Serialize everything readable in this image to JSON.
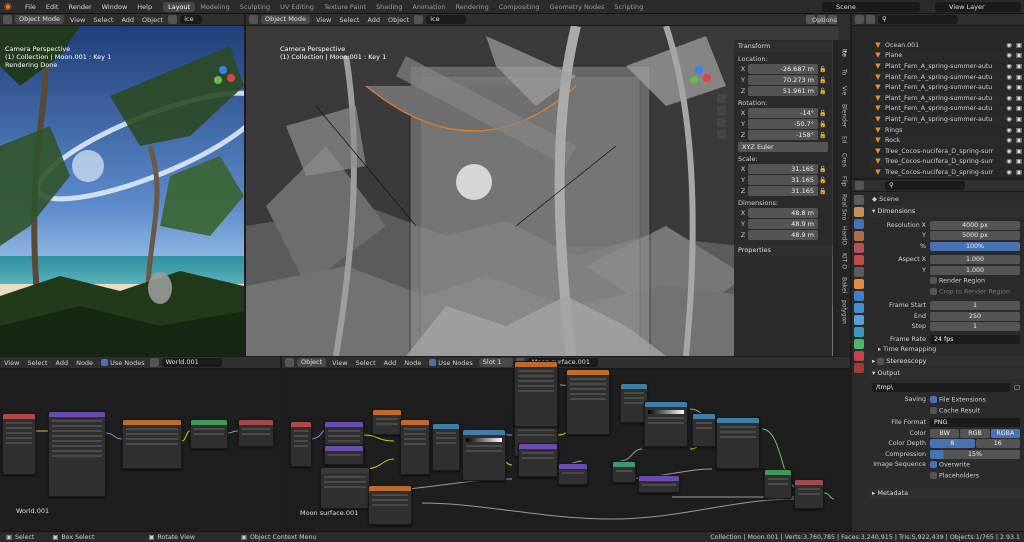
{
  "menu": {
    "items": [
      "File",
      "Edit",
      "Render",
      "Window",
      "Help"
    ]
  },
  "workspaces": [
    {
      "label": "Layout",
      "active": true
    },
    {
      "label": "Modeling",
      "active": false
    },
    {
      "label": "Sculpting",
      "active": false
    },
    {
      "label": "UV Editing",
      "active": false
    },
    {
      "label": "Texture Paint",
      "active": false
    },
    {
      "label": "Shading",
      "active": false
    },
    {
      "label": "Animation",
      "active": false
    },
    {
      "label": "Rendering",
      "active": false
    },
    {
      "label": "Compositing",
      "active": false
    },
    {
      "label": "Geometry Nodes",
      "active": false
    },
    {
      "label": "Scripting",
      "active": false
    }
  ],
  "scene": {
    "name": "Scene",
    "view_layer": "View Layer"
  },
  "left_viewport": {
    "mode": "Object Mode",
    "menus": [
      "View",
      "Select",
      "Add",
      "Object"
    ],
    "transform_orientation": "Global",
    "search": "ice",
    "overlay_lines": [
      "Camera Perspective",
      "(1) Collection | Moon.001 : Key 1",
      "Rendering Done"
    ],
    "options_label": "Opti"
  },
  "main_viewport": {
    "mode": "Object Mode",
    "menus": [
      "View",
      "Select",
      "Add",
      "Object"
    ],
    "transform_orientation": "Global",
    "search": "ice",
    "options_label": "Options",
    "overlay_lines": [
      "Camera Perspective",
      "(1) Collection | Moon.001 : Key 1"
    ],
    "side_tabs": [
      "Ite",
      "To",
      "Vie",
      "Blender",
      "Ed",
      "Crea",
      "Flip",
      "Real Sno",
      "HardO",
      "KIT O",
      "Bakel",
      "polygon"
    ]
  },
  "npanel": {
    "transform_title": "Transform",
    "location_label": "Location:",
    "location": [
      {
        "ax": "X",
        "val": "-26.687 m"
      },
      {
        "ax": "Y",
        "val": "70.273 m"
      },
      {
        "ax": "Z",
        "val": "51.961 m"
      }
    ],
    "rotation_label": "Rotation:",
    "rotation": [
      {
        "ax": "X",
        "val": "-14°"
      },
      {
        "ax": "Y",
        "val": "-50.7°"
      },
      {
        "ax": "Z",
        "val": "-158°"
      }
    ],
    "rotation_mode": "XYZ Euler",
    "scale_label": "Scale:",
    "scale": [
      {
        "ax": "X",
        "val": "31.165"
      },
      {
        "ax": "Y",
        "val": "31.165"
      },
      {
        "ax": "Z",
        "val": "31.165"
      }
    ],
    "dimensions_label": "Dimensions:",
    "dimensions": [
      {
        "ax": "X",
        "val": "48.8 m"
      },
      {
        "ax": "Y",
        "val": "48.9 m"
      },
      {
        "ax": "Z",
        "val": "48.9 m"
      }
    ],
    "properties_title": "Properties"
  },
  "outliner": {
    "rows": [
      "Ocean.001",
      "Plane",
      "Plant_Fern_A_spring-summer-autu",
      "Plant_Fern_A_spring-summer-autu",
      "Plant_Fern_A_spring-summer-autu",
      "Plant_Fern_A_spring-summer-autu",
      "Plant_Fern_A_spring-summer-autu",
      "Plant_Fern_A_spring-summer-autu",
      "Rings",
      "Rock",
      "Tree_Cocos-nucifera_D_spring-surr",
      "Tree_Cocos-nucifera_D_spring-surr",
      "Tree_Cocos-nucifera_D_spring-surr"
    ]
  },
  "properties": {
    "breadcrumb": "Scene",
    "dimensions_title": "Dimensions",
    "resolution_x_label": "Resolution X",
    "resolution_x": "4000 px",
    "resolution_y_label": "Y",
    "resolution_y": "5000 px",
    "percent_label": "%",
    "percent": "100%",
    "aspect_x_label": "Aspect X",
    "aspect_x": "1.000",
    "aspect_y_label": "Y",
    "aspect_y": "1.000",
    "render_region": "Render Region",
    "crop_region": "Crop to Render Region",
    "frame_start_label": "Frame Start",
    "frame_start": "1",
    "frame_end_label": "End",
    "frame_end": "250",
    "frame_step_label": "Step",
    "frame_step": "1",
    "frame_rate_label": "Frame Rate",
    "frame_rate": "24 fps",
    "time_remapping": "Time Remapping",
    "stereoscopy": "Stereoscopy",
    "output_title": "Output",
    "output_path": "/tmp\\",
    "saving_label": "Saving",
    "file_extensions": "File Extensions",
    "cache_result": "Cache Result",
    "file_format_label": "File Format",
    "file_format": "PNG",
    "color_label": "Color",
    "color_options": [
      "BW",
      "RGB",
      "RGBA"
    ],
    "color_depth_label": "Color Depth",
    "color_depth_options": [
      "8",
      "16"
    ],
    "compression_label": "Compression",
    "compression": "15%",
    "image_sequence_label": "Image Sequence",
    "overwrite": "Overwrite",
    "placeholders": "Placeholders",
    "metadata": "Metadata"
  },
  "world_nodes": {
    "menus": [
      "View",
      "Select",
      "Add",
      "Node"
    ],
    "use_nodes": "Use Nodes",
    "datablock": "World.001",
    "label": "World.001"
  },
  "material_nodes": {
    "object_type": "Object",
    "menus": [
      "View",
      "Select",
      "Add",
      "Node"
    ],
    "use_nodes": "Use Nodes",
    "slot": "Slot 1",
    "material": "Moon surface.001",
    "label": "Moon surface.001"
  },
  "statusbar": {
    "select": "Select",
    "box_select": "Box Select",
    "rotate_view": "Rotate View",
    "context_menu": "Object Context Menu",
    "stats": "Collection | Moon.001 | Verts:3,760,785 | Faces:3,240,915 | Tris:5,922,439 | Objects:1/765 | 2.93.1"
  },
  "colors": {
    "accent": "#4772b3",
    "active_orange": "#e87d0d",
    "header": "#2f2f2f"
  }
}
